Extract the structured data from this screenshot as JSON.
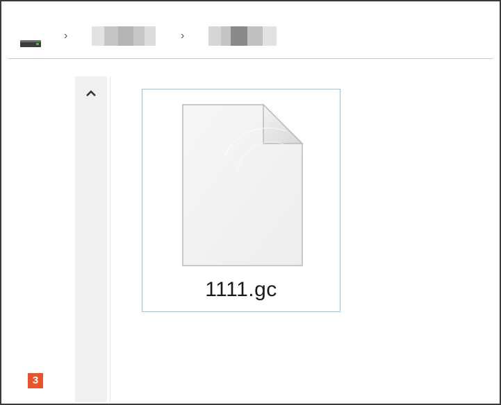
{
  "breadcrumb": {
    "separator": "›"
  },
  "scrollbar": {
    "up_arrow": "▲"
  },
  "file": {
    "name": "1111.gc",
    "icon": "blank-document-icon",
    "selected": true
  },
  "annotation": {
    "step_number": "3"
  },
  "colors": {
    "selection_border": "#8fc3ea",
    "badge_background": "#e8542b",
    "drive_accent": "#32c832"
  }
}
